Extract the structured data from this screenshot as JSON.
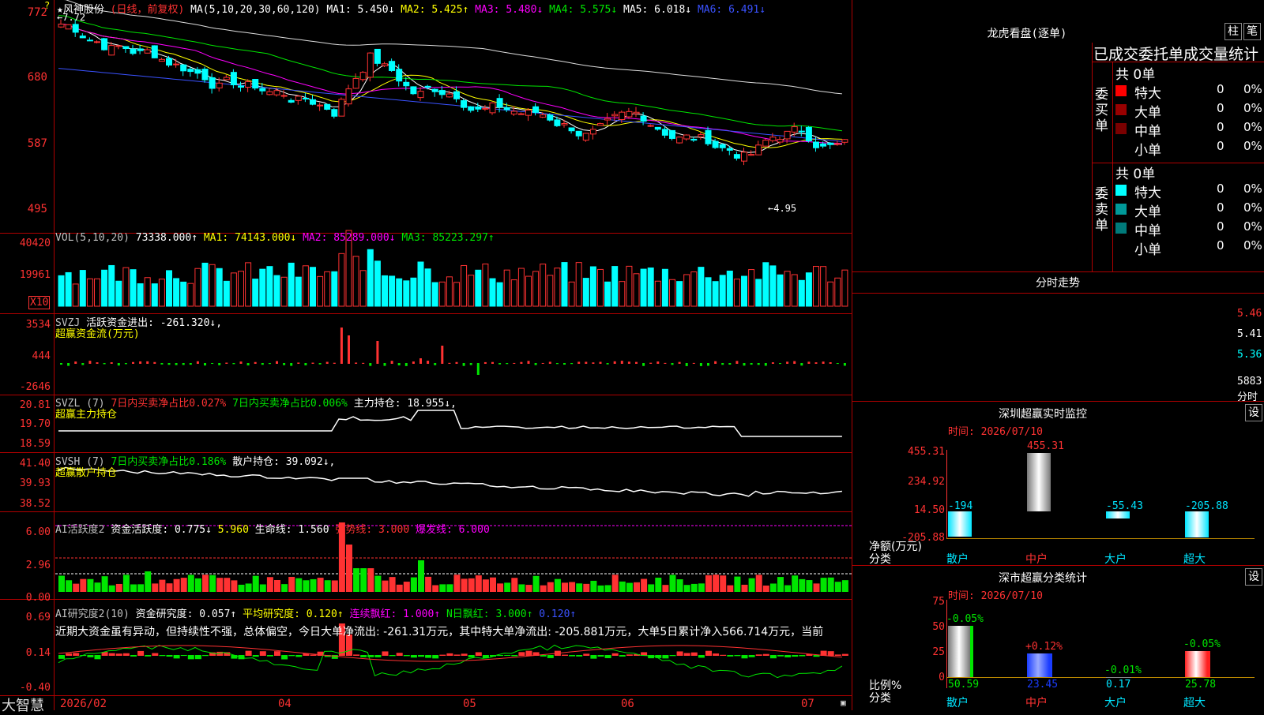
{
  "main": {
    "price_labels": [
      "772",
      "680",
      "587",
      "495"
    ],
    "title": {
      "name": "★风神股份",
      "mode": "(日线，前复权)",
      "ma_def": "MA(5,10,20,30,60,120)",
      "ma1": "MA1: 5.450↓",
      "ma2": "MA2: 5.425↑",
      "ma3": "MA3: 5.480↓",
      "ma4": "MA4: 5.575↓",
      "ma5": "MA5: 6.018↓",
      "ma6": "MA6: 6.491↓"
    },
    "high_mark": "←7.72",
    "low_mark": "←4.95"
  },
  "vol": {
    "labels": [
      "40420",
      "19961",
      "X10"
    ],
    "title": {
      "name": "VOL(5,10,20)",
      "val": "73338.000↑",
      "ma1": "MA1: 74143.000↓",
      "ma2": "MA2: 85289.000↓",
      "ma3": "MA3: 85223.297↑"
    }
  },
  "svzj": {
    "labels": [
      "3534",
      "444",
      "-2646"
    ],
    "title": {
      "name": "SVZJ",
      "val": "活跃资金进出: -261.320↓,",
      "sub": "超赢资金流(万元)"
    }
  },
  "svzl": {
    "labels": [
      "20.81",
      "19.70",
      "18.59"
    ],
    "title": {
      "name": "SVZL (7)",
      "a": "7日内买卖净占比0.027%",
      "b": "7日内买卖净占比0.006%",
      "c": "主力持仓: 18.955↓,",
      "sub": "超赢主力持仓"
    }
  },
  "svsh": {
    "labels": [
      "41.40",
      "39.93",
      "38.52"
    ],
    "title": {
      "name": "SVSH (7)",
      "a": "7日内买卖净占比0.186%",
      "c": "散户持仓: 39.092↓,",
      "sub": "超赢散户持仓"
    }
  },
  "ai1": {
    "labels": [
      "6.00",
      "2.96",
      "0.00"
    ],
    "title": {
      "name": "AI活跃度2",
      "a": "资金活跃度: 0.775↓",
      "b": "5.960",
      "c": "生命线: 1.560",
      "d": "强势线: 3.000",
      "e": "爆发线: 6.000"
    }
  },
  "ai2": {
    "labels": [
      "0.69",
      "0.14",
      "-0.40"
    ],
    "title": {
      "name": "AI研究度2(10)",
      "a": "资金研究度: 0.057↑",
      "b": "平均研究度: 0.120↑",
      "c": "连续飘红: 1.000↑",
      "d": "N日飘红: 3.000↑",
      "e": "0.120↑"
    },
    "note": "近期大资金虽有异动，但持续性不强，总体偏空，今日大单净流出: -261.31万元，其中特大单净流出: -205.881万元，大单5日累计净入566.714万元，当前"
  },
  "xaxis": [
    "2026/02",
    "04",
    "05",
    "06",
    "07"
  ],
  "brand": "大智慧",
  "lhb": {
    "title": "龙虎看盘(逐单)",
    "btn1": "柱",
    "btn2": "笔",
    "subtitle": "已成交委托单成交量统计",
    "buy_total": "共 0单",
    "sell_total": "共 0单",
    "buy_side": "委买单",
    "sell_side": "委卖单",
    "buy_rows": [
      {
        "name": "特大",
        "v": "0",
        "p": "0%"
      },
      {
        "name": "大单",
        "v": "0",
        "p": "0%"
      },
      {
        "name": "中单",
        "v": "0",
        "p": "0%"
      },
      {
        "name": "小单",
        "v": "0",
        "p": "0%"
      }
    ],
    "sell_rows": [
      {
        "name": "特大",
        "v": "0",
        "p": "0%"
      },
      {
        "name": "大单",
        "v": "0",
        "p": "0%"
      },
      {
        "name": "中单",
        "v": "0",
        "p": "0%"
      },
      {
        "name": "小单",
        "v": "0",
        "p": "0%"
      }
    ],
    "buy_colors": [
      "#ff0000",
      "#990000",
      "#7a0000",
      "#000000"
    ],
    "sell_colors": [
      "#00ffff",
      "#009999",
      "#007a7a",
      "#000000"
    ]
  },
  "fenshi": {
    "title": "分时走势",
    "labels": [
      "5.46",
      "5.41",
      "5.36",
      "5883",
      "分时"
    ]
  },
  "szmon": {
    "title": "深圳超赢实时监控",
    "btn": "设",
    "time": "时间: 2026/07/10",
    "ylabels": [
      "455.31",
      "234.92",
      "14.50",
      "-205.88"
    ],
    "ytitle": "净额(万元)",
    "xtitle": "分类",
    "categories": [
      "散户",
      "中户",
      "大户",
      "超大"
    ],
    "bar_labels": [
      "-194",
      "455.31",
      "-55.43",
      "-205.88"
    ],
    "values": [
      -194,
      455.31,
      -55.43,
      -205.88
    ]
  },
  "szstat": {
    "title": "深市超赢分类统计",
    "btn": "设",
    "time": "时间: 2026/07/10",
    "ylabels": [
      "75",
      "50",
      "25",
      "0"
    ],
    "ytitle": "比例%",
    "xtitle": "分类",
    "categories": [
      "散户",
      "中户",
      "大户",
      "超大"
    ],
    "top_labels": [
      "-0.05%",
      "+0.12%",
      "-0.01%",
      "-0.05%"
    ],
    "bottom_labels": [
      "50.59",
      "23.45",
      "0.17",
      "25.78"
    ],
    "values": [
      50.59,
      23.45,
      0.17,
      25.78
    ]
  }
}
